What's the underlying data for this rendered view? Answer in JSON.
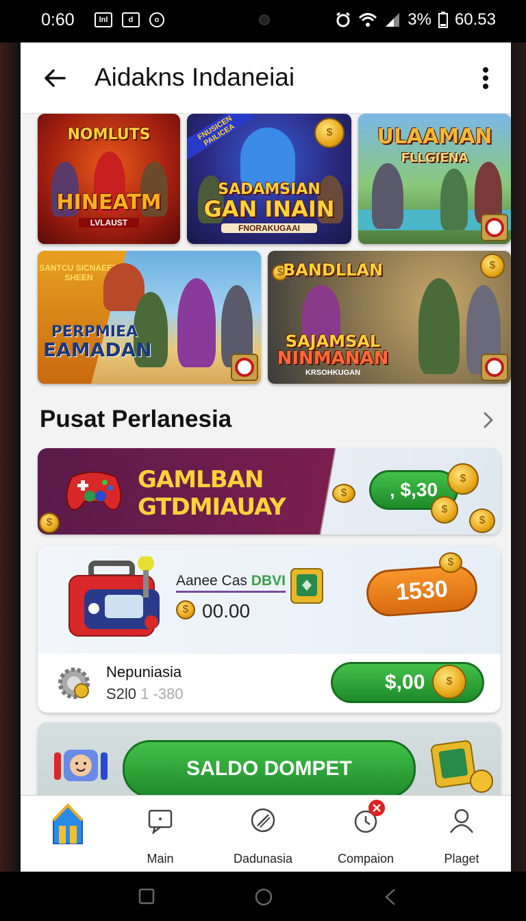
{
  "status_bar": {
    "time": "0:60",
    "left_icons": [
      "lnl",
      "d",
      "o"
    ],
    "battery": "3%",
    "clock_right": "60.53"
  },
  "app_bar": {
    "title": "Aidakns Indaneiai"
  },
  "games": [
    {
      "title": "NOMLUTS",
      "title2": "HINEATM",
      "sub": "LVLAUST"
    },
    {
      "title": "SADAMSIAN",
      "title2": "GAN INAIN",
      "sub": "FNORAKUGAAI",
      "tag": "FNUSICEN PAILICEA"
    },
    {
      "title": "ULAAMAN",
      "title2": "FLLGIENA"
    },
    {
      "title": "PERPMIEA",
      "title2": "EAMADAN",
      "tag": "SANTCU SICNAEER SHEEN"
    },
    {
      "title": "BANDLLAN",
      "title2": "SAJAMSAL",
      "title3": "NINMANAN",
      "sub": "KRSOHKUGAN"
    }
  ],
  "section": {
    "title": "Pusat Perlanesia"
  },
  "promo": {
    "line1": "GAMLBAN",
    "line2": "GTDMIAUAY",
    "amount": "‚ $,30"
  },
  "wallet": {
    "label": "Aanee Cas ",
    "label_accent": "DBVI",
    "amount": "00.00",
    "badge_amount": "1530",
    "bottom_name": "Nepuniasia",
    "bottom_range_main": "S2l0",
    "bottom_range_muted": " 1 -380",
    "bottom_amount": "$,00"
  },
  "saldo": {
    "button_label": "SALDO DOMPET"
  },
  "bottom_nav": [
    {
      "label": "",
      "icon": "home-icon"
    },
    {
      "label": "Main",
      "icon": "message-icon"
    },
    {
      "label": "Dadunasia",
      "icon": "compass-icon"
    },
    {
      "label": "Compaion",
      "icon": "clock-icon"
    },
    {
      "label": "Plaget",
      "icon": "profile-icon"
    }
  ],
  "colors": {
    "accent_green": "#2fa83a",
    "accent_orange": "#e87a18",
    "notification_red": "#e02020"
  }
}
